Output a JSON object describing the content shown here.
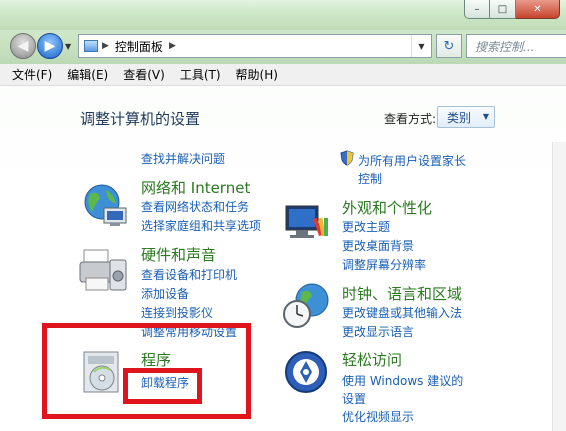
{
  "window": {
    "min_label": "–",
    "max_label": "□",
    "close_label": "✕"
  },
  "address": {
    "path": "控制面板",
    "search_placeholder": "搜索控制..."
  },
  "menu": [
    "文件(F)",
    "编辑(E)",
    "查看(V)",
    "工具(T)",
    "帮助(H)"
  ],
  "main": {
    "title": "调整计算机的设置",
    "view_by_label": "查看方式:",
    "view_by_value": "类别"
  },
  "categories": {
    "system_security_link": "查找并解决问题",
    "network": {
      "title": "网络和 Internet",
      "links": [
        "查看网络状态和任务",
        "选择家庭组和共享选项"
      ]
    },
    "hardware": {
      "title": "硬件和声音",
      "links": [
        "查看设备和打印机",
        "添加设备",
        "连接到投影仪",
        "调整常用移动设置"
      ]
    },
    "programs": {
      "title": "程序",
      "links": [
        "卸载程序"
      ]
    },
    "user_accounts": {
      "links": [
        "为所有用户设置家长",
        "控制"
      ]
    },
    "appearance": {
      "title": "外观和个性化",
      "links": [
        "更改主题",
        "更改桌面背景",
        "调整屏幕分辨率"
      ]
    },
    "clock": {
      "title": "时钟、语言和区域",
      "links": [
        "更改键盘或其他输入法",
        "更改显示语言"
      ]
    },
    "ease": {
      "title": "轻松访问",
      "links": [
        "使用 Windows 建议的",
        "设置",
        "优化视频显示"
      ]
    }
  },
  "colors": {
    "category_title": "#2a7a1f",
    "link": "#1a5fb4",
    "annotation": "#e0141c"
  }
}
